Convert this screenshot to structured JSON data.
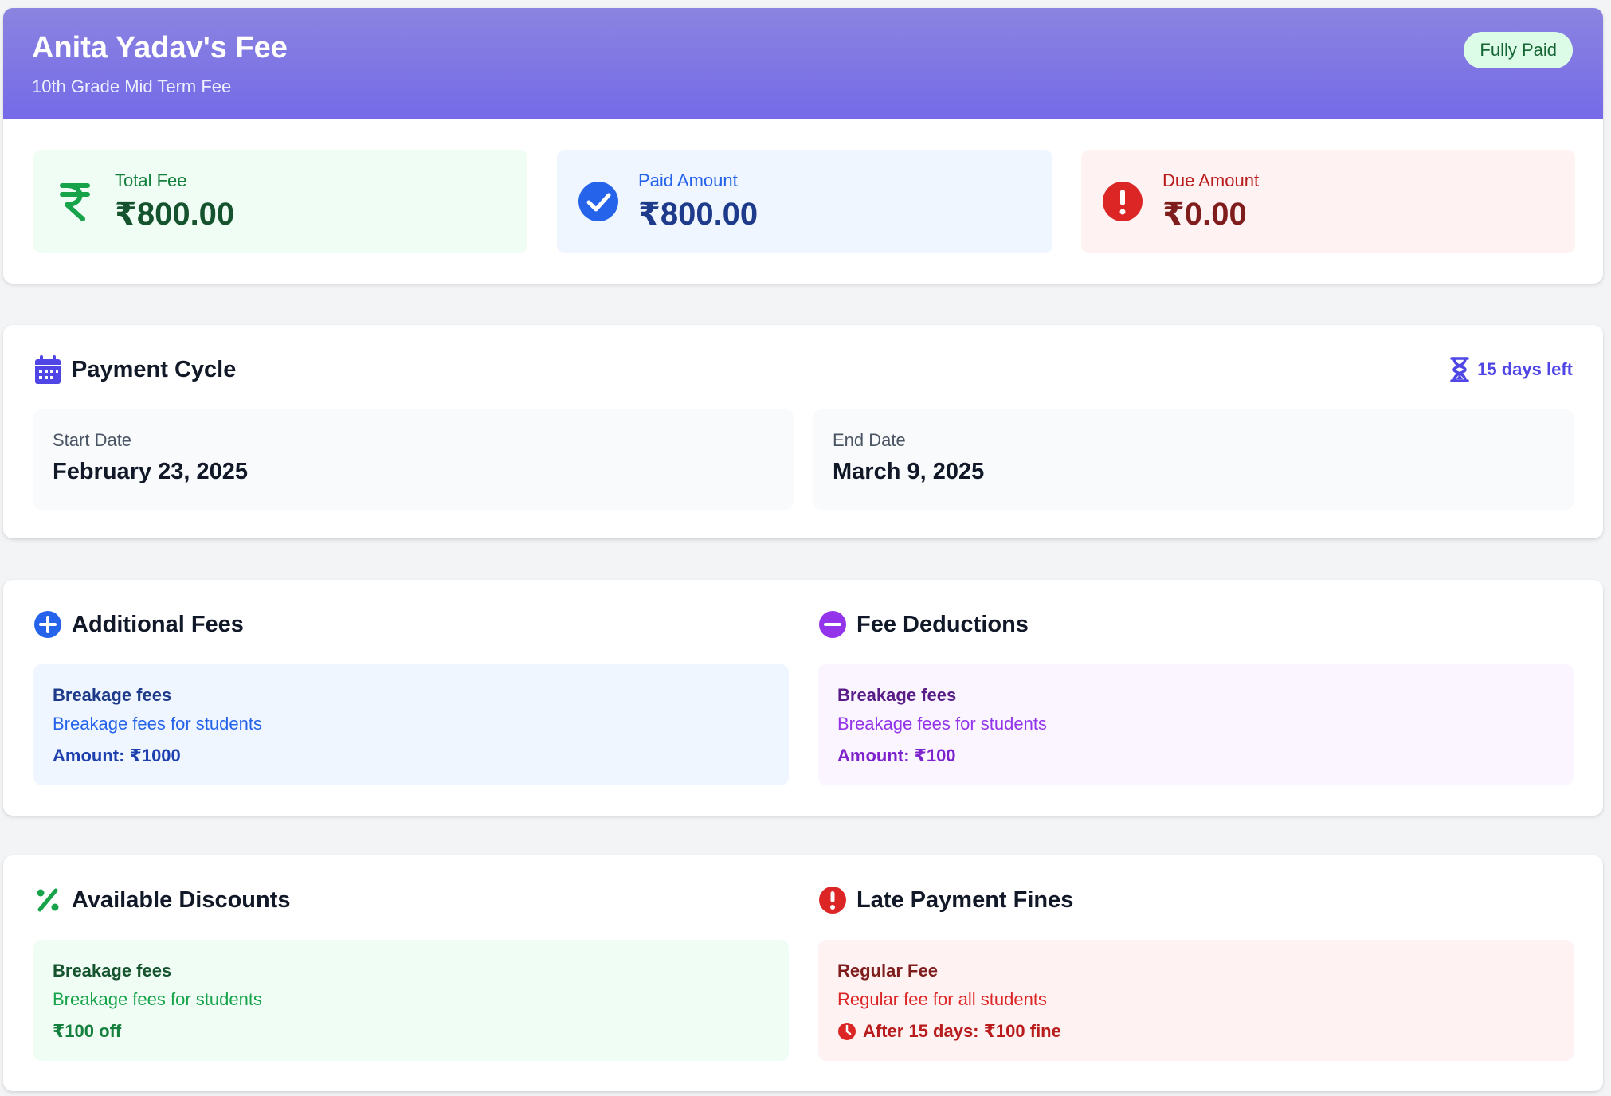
{
  "header": {
    "title": "Anita Yadav's Fee",
    "subtitle": "10th Grade Mid Term Fee",
    "status_badge": "Fully Paid"
  },
  "stats": {
    "total": {
      "label": "Total Fee",
      "amount": "₹800.00",
      "icon": "rupee-icon"
    },
    "paid": {
      "label": "Paid Amount",
      "amount": "₹800.00",
      "icon": "check-circle-icon"
    },
    "due": {
      "label": "Due Amount",
      "amount": "₹0.00",
      "icon": "alert-circle-icon"
    }
  },
  "payment_cycle": {
    "title": "Payment Cycle",
    "days_left": "15 days left",
    "start_label": "Start Date",
    "start_date": "February 23, 2025",
    "end_label": "End Date",
    "end_date": "March 9, 2025"
  },
  "additional_fees": {
    "title": "Additional Fees",
    "items": [
      {
        "name": "Breakage fees",
        "description": "Breakage fees for students",
        "amount": "Amount: ₹1000"
      }
    ]
  },
  "fee_deductions": {
    "title": "Fee Deductions",
    "items": [
      {
        "name": "Breakage fees",
        "description": "Breakage fees for students",
        "amount": "Amount: ₹100"
      }
    ]
  },
  "discounts": {
    "title": "Available Discounts",
    "items": [
      {
        "name": "Breakage fees",
        "description": "Breakage fees for students",
        "amount": "₹100 off"
      }
    ]
  },
  "late_fines": {
    "title": "Late Payment Fines",
    "items": [
      {
        "name": "Regular Fee",
        "description": "Regular fee for all students",
        "rule": "After 15 days: ₹100 fine"
      }
    ]
  },
  "colors": {
    "header_gradient_top": "#8b84e0",
    "header_gradient_bottom": "#756ae8",
    "accent_indigo": "#4f46e5",
    "success_green": "#16a34a",
    "info_blue": "#2563eb",
    "danger_red": "#dc2626",
    "purple": "#9333ea"
  }
}
